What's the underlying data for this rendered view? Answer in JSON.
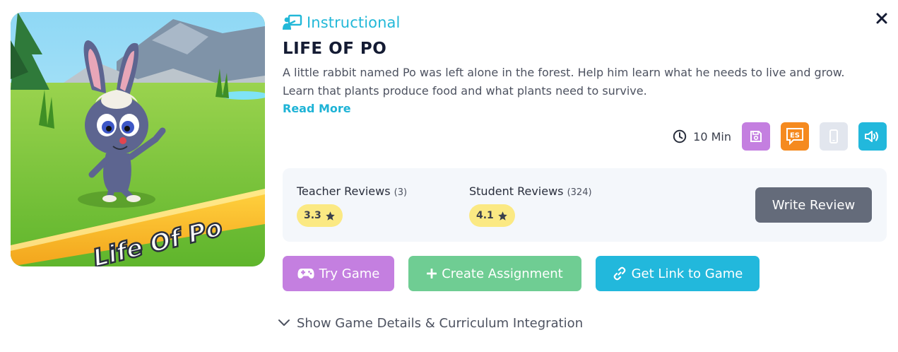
{
  "game": {
    "category": "Instructional",
    "title": "LIFE OF PO",
    "description": "A little rabbit named Po was left alone in the forest. Help him learn what he needs to live and grow. Learn that plants produce food and what plants need to survive.",
    "read_more": "Read More",
    "thumbnail_text": "Life Of Po"
  },
  "meta": {
    "duration": "10 Min",
    "features": [
      {
        "icon": "save-icon",
        "color": "#c47fe0"
      },
      {
        "icon": "spanish-es-icon",
        "label": "ES",
        "color": "#f58a1f"
      },
      {
        "icon": "mobile-device-icon",
        "color": "#e2e6ee"
      },
      {
        "icon": "audio-speaker-icon",
        "color": "#22b8dc"
      }
    ]
  },
  "reviews": {
    "teacher": {
      "label": "Teacher Reviews",
      "count": "(3)",
      "rating": "3.3"
    },
    "student": {
      "label": "Student Reviews",
      "count": "(324)",
      "rating": "4.1"
    },
    "write_review": "Write Review"
  },
  "actions": {
    "try_game": "Try Game",
    "create_assignment": "Create Assignment",
    "get_link": "Get Link to Game"
  },
  "details_toggle": "Show Game Details & Curriculum Integration",
  "colors": {
    "accent": "#22b8d8",
    "try_game": "#c47fe0",
    "create_assignment": "#6fcd93",
    "get_link": "#22b8dc",
    "write_review": "#646b7a",
    "rating_pill": "#fbe983"
  }
}
